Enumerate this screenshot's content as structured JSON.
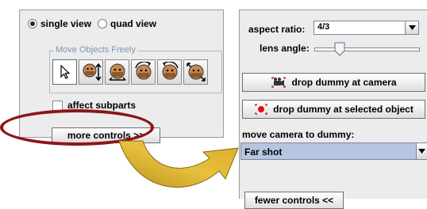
{
  "left_panel": {
    "view_options": [
      {
        "label": "single view",
        "selected": true
      },
      {
        "label": "quad view",
        "selected": false
      }
    ],
    "group_title": "Move Objects Freely",
    "tools": [
      "select-arrow-icon",
      "move-vertical-icon",
      "move-icon",
      "rotate-icon",
      "rotate-icon",
      "scale-icon"
    ],
    "affect_subparts_label": "affect subparts",
    "affect_subparts_checked": false,
    "more_controls_label": "more controls  >>"
  },
  "right_panel": {
    "aspect_ratio_label": "aspect ratio:",
    "aspect_ratio_value": "4/3",
    "lens_angle_label": "lens angle:",
    "drop_camera_label": "drop dummy at camera",
    "drop_selected_label": "drop dummy at selected object",
    "move_camera_label": "move camera to dummy:",
    "shot_value": "Far shot",
    "fewer_controls_label": "fewer controls  <<"
  },
  "colors": {
    "highlight_ellipse": "#8f1418",
    "arrow_fill": "#d4ac2c",
    "selected_combo": "#b6c6e0",
    "group_title": "#7f95b4"
  }
}
